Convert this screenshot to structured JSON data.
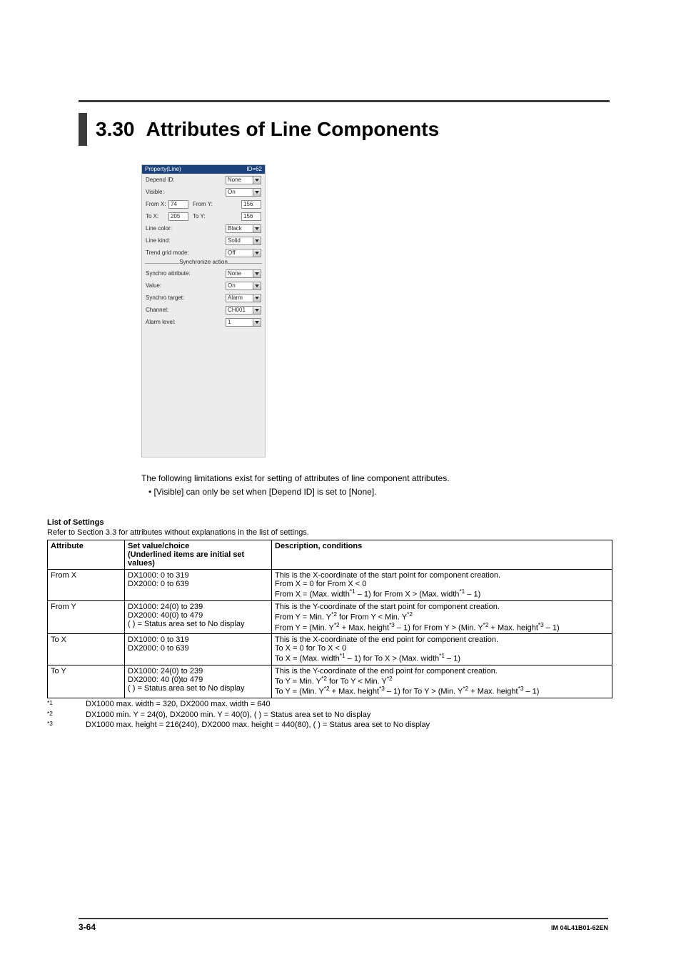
{
  "header": {
    "section_number": "3.30",
    "section_title": "Attributes of Line Components"
  },
  "panel": {
    "title_left": "Property(Line)",
    "title_right": "ID=62",
    "depend_id_label": "Depend ID:",
    "depend_id_value": "None",
    "visible_label": "Visible:",
    "visible_value": "On",
    "from_x_label": "From X:",
    "from_x_value": "74",
    "from_y_label": "From Y:",
    "from_y_value": "156",
    "to_x_label": "To X:",
    "to_x_value": "205",
    "to_y_label": "To Y:",
    "to_y_value": "156",
    "line_color_label": "Line color:",
    "line_color_value": "Black",
    "line_kind_label": "Line kind:",
    "line_kind_value": "Solid",
    "trend_grid_label": "Trend grid mode:",
    "trend_grid_value": "Off",
    "sync_legend": "Synchronize action",
    "sync_attr_label": "Synchro attribute:",
    "sync_attr_value": "None",
    "value_label": "Value:",
    "value_value": "On",
    "sync_target_label": "Synchro target:",
    "sync_target_value": "Alarm",
    "channel_label": "Channel:",
    "channel_value": "CH001",
    "alarm_level_label": "Alarm level:",
    "alarm_level_value": "1"
  },
  "intro": {
    "line1": "The following limitations exist for setting of attributes of line component attributes.",
    "bullet1_prefix": "•   ",
    "bullet1": "[Visible] can only be set when [Depend ID] is set to [None]."
  },
  "settings": {
    "heading": "List of Settings",
    "sub": "Refer to Section 3.3 for attributes without explanations in the list of settings.",
    "col_attr": "Attribute",
    "col_set": "Set value/choice\n(Underlined items are initial set values)",
    "col_desc": "Description, conditions",
    "rows": [
      {
        "attr": "From X",
        "set": "DX1000: 0 to 319\nDX2000: 0 to 639",
        "desc": "This is the X-coordinate of the start point for component creation.\nFrom X = 0 for From X < 0\nFrom X = (Max. width*1 – 1) for From X > (Max. width*1 – 1)"
      },
      {
        "attr": "From Y",
        "set": "DX1000: 24(0) to 239\nDX2000: 40(0) to 479\n(   ) = Status area set to No display",
        "desc": "This is the Y-coordinate of the start point for component creation.\nFrom Y = Min. Y*2 for From Y < Min. Y*2\nFrom Y = (Min. Y*2 + Max. height*3 – 1) for From Y > (Min. Y*2 + Max. height*3 – 1)"
      },
      {
        "attr": "To X",
        "set": "DX1000: 0 to 319\nDX2000: 0 to 639",
        "desc": "This is the X-coordinate of the end point for component creation.\nTo X = 0 for To X < 0\nTo X = (Max. width*1 – 1) for To X > (Max. width*1 – 1)"
      },
      {
        "attr": "To Y",
        "set": "DX1000: 24(0) to 239\nDX2000: 40 (0)to 479\n(   ) = Status area set to No display",
        "desc": "This is the Y-coordinate of the end point for component creation.\nTo Y = Min. Y*2 for To Y < Min. Y*2\nTo Y = (Min. Y*2 + Max. height*3 – 1) for To Y > (Min. Y*2 + Max. height*3 – 1)"
      }
    ]
  },
  "footnotes": {
    "f1_mark": "*1",
    "f1_text": "DX1000 max. width = 320, DX2000 max. width = 640",
    "f2_mark": "*2",
    "f2_text": "DX1000 min. Y = 24(0), DX2000 min. Y = 40(0), (   ) = Status area set to No display",
    "f3_mark": "*3",
    "f3_text": "DX1000 max. height = 216(240), DX2000 max. height = 440(80), (   ) = Status area set to No display"
  },
  "footer": {
    "page": "3-64",
    "doc": "IM 04L41B01-62EN"
  }
}
